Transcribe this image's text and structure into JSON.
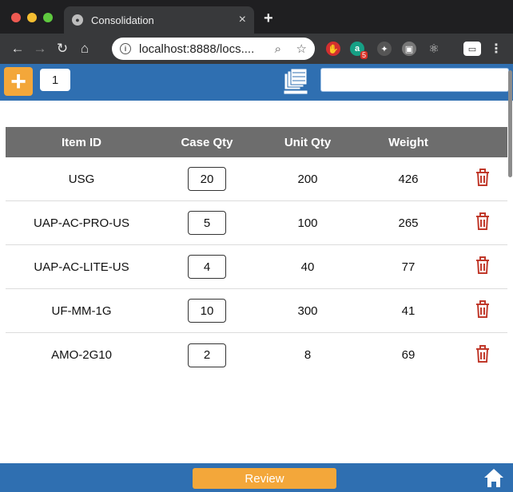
{
  "browser": {
    "tab_title": "Consolidation",
    "tab_close": "×",
    "new_tab": "+",
    "url": "localhost:8888/locs....",
    "extension_badge": "5"
  },
  "app": {
    "add_label": "+",
    "count_value": "1",
    "search_value": "",
    "colors": {
      "bar": "#2f6fb1",
      "accent": "#f3a73a",
      "delete": "#c0392b",
      "header": "#6d6d6d"
    }
  },
  "table": {
    "headers": [
      "Item ID",
      "Case Qty",
      "Unit Qty",
      "Weight",
      ""
    ],
    "rows": [
      {
        "item_id": "USG",
        "case_qty": "20",
        "unit_qty": "200",
        "weight": "426"
      },
      {
        "item_id": "UAP-AC-PRO-US",
        "case_qty": "5",
        "unit_qty": "100",
        "weight": "265"
      },
      {
        "item_id": "UAP-AC-LITE-US",
        "case_qty": "4",
        "unit_qty": "40",
        "weight": "77"
      },
      {
        "item_id": "UF-MM-1G",
        "case_qty": "10",
        "unit_qty": "300",
        "weight": "41"
      },
      {
        "item_id": "AMO-2G10",
        "case_qty": "2",
        "unit_qty": "8",
        "weight": "69"
      }
    ]
  },
  "footer": {
    "review_label": "Review"
  }
}
